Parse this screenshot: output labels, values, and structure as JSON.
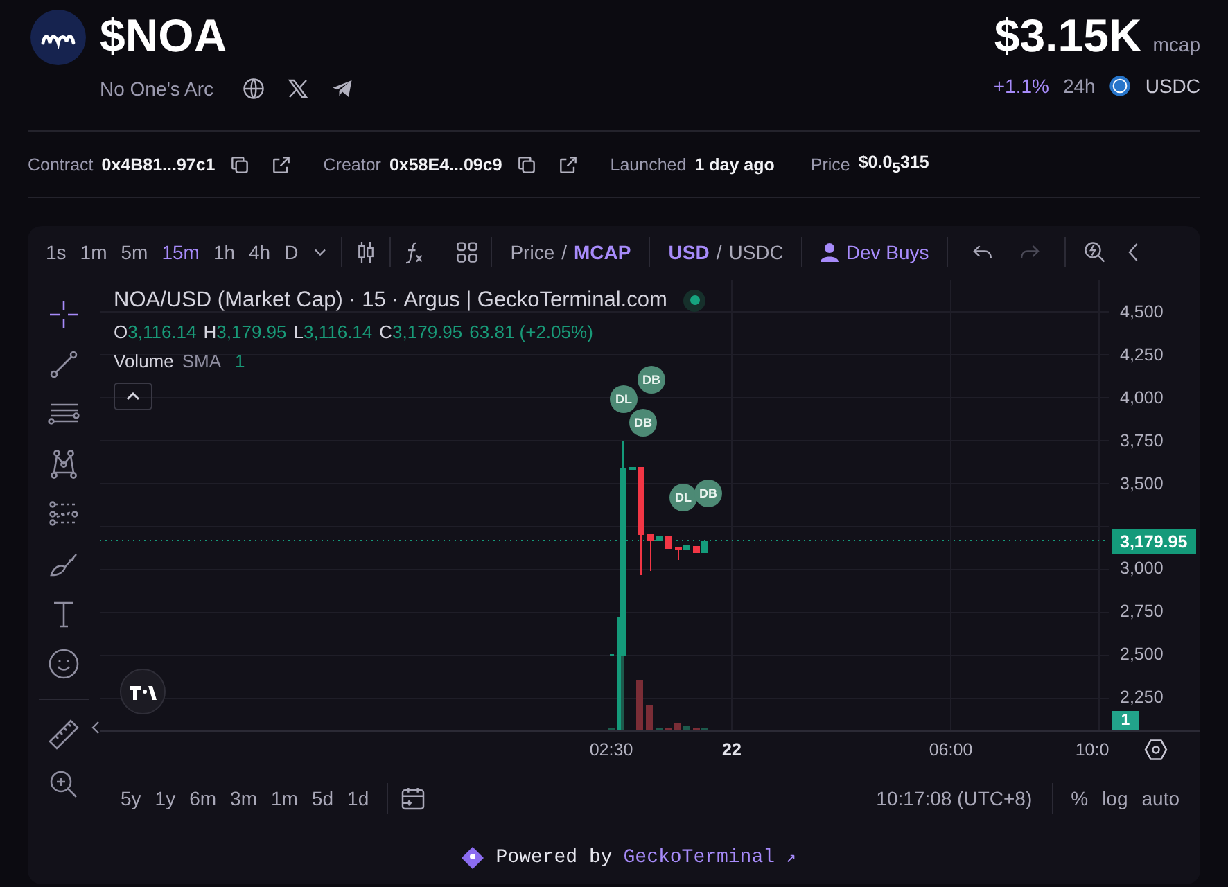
{
  "token": {
    "symbol": "$NOA",
    "name": "No One's Arc",
    "mcap": "$3.15K",
    "mcap_label": "mcap",
    "change": "+1.1%",
    "period": "24h",
    "quote": "USDC"
  },
  "info": [
    {
      "label": "Contract",
      "value": "0x4B81...97c1",
      "kind": "address"
    },
    {
      "label": "Creator",
      "value": "0x58E4...09c9",
      "kind": "address"
    },
    {
      "label": "Launched",
      "value": "1 day ago",
      "kind": "plain"
    },
    {
      "label": "Price",
      "value": "$0.0$_{5}$315",
      "kind": "plain"
    }
  ],
  "toolbar": {
    "intervals": [
      {
        "label": "1s",
        "selected": false
      },
      {
        "label": "1m",
        "selected": false
      },
      {
        "label": "5m",
        "selected": false
      },
      {
        "label": "15m",
        "selected": true
      },
      {
        "label": "1h",
        "selected": false
      },
      {
        "label": "4h",
        "selected": false
      },
      {
        "label": "D",
        "selected": false
      }
    ],
    "price_modes": [
      {
        "label": "Price",
        "selected": false
      },
      {
        "label": "MCAP",
        "selected": true
      }
    ],
    "currencies": [
      {
        "label": "USD",
        "selected": true
      },
      {
        "label": "USDC",
        "selected": false
      }
    ],
    "separator": "/",
    "dev_buys": "Dev Buys",
    "redo_disabled": true
  },
  "drawing_tools": [
    {
      "kind": "crosshair",
      "selected": true
    },
    {
      "kind": "trendline",
      "selected": false
    },
    {
      "kind": "lines",
      "selected": false
    },
    {
      "kind": "pattern",
      "selected": false
    },
    {
      "kind": "fib",
      "selected": false
    },
    {
      "kind": "brush",
      "selected": false
    },
    {
      "kind": "text",
      "selected": false
    },
    {
      "kind": "emoji",
      "selected": false
    },
    {
      "kind": "ruler",
      "selected": false
    },
    {
      "kind": "zoom",
      "selected": false
    }
  ],
  "legend": {
    "title": "NOA/USD (Market Cap) · 15 · Argus | GeckoTerminal.com",
    "ohlc": [
      {
        "key": "O",
        "value": "3,116.14"
      },
      {
        "key": "H",
        "value": "3,179.95"
      },
      {
        "key": "L",
        "value": "3,116.14"
      },
      {
        "key": "C",
        "value": "3,179.95"
      }
    ],
    "change": "63.81 (+2.05%)",
    "volume": "Volume",
    "sma": "SMA",
    "sma_value": "1"
  },
  "markers": [
    {
      "label": "DL"
    },
    {
      "label": "DB"
    },
    {
      "label": "DB"
    },
    {
      "label": "DL"
    },
    {
      "label": "DB"
    }
  ],
  "price_ticks_upper": [
    "4,500",
    "4,250",
    "4,000",
    "3,750",
    "3,500"
  ],
  "price_ticks_lower": [
    "3,000",
    "2,750",
    "2,500",
    "2,250"
  ],
  "last_price": "3,179.95",
  "volume_badge": "1",
  "time_ticks": [
    {
      "label": "02:30",
      "kind": "time"
    },
    {
      "label": "22",
      "kind": "date"
    },
    {
      "label": "06:00",
      "kind": "time"
    },
    {
      "label": "10:0",
      "kind": "time"
    }
  ],
  "ranges": [
    "5y",
    "1y",
    "6m",
    "3m",
    "1m",
    "5d",
    "1d"
  ],
  "clock": "10:17:08 (UTC+8)",
  "scale_options": [
    "%",
    "log",
    "auto"
  ],
  "footer": {
    "prefix": "Powered by",
    "brand": "GeckoTerminal",
    "arrow": "↗"
  }
}
